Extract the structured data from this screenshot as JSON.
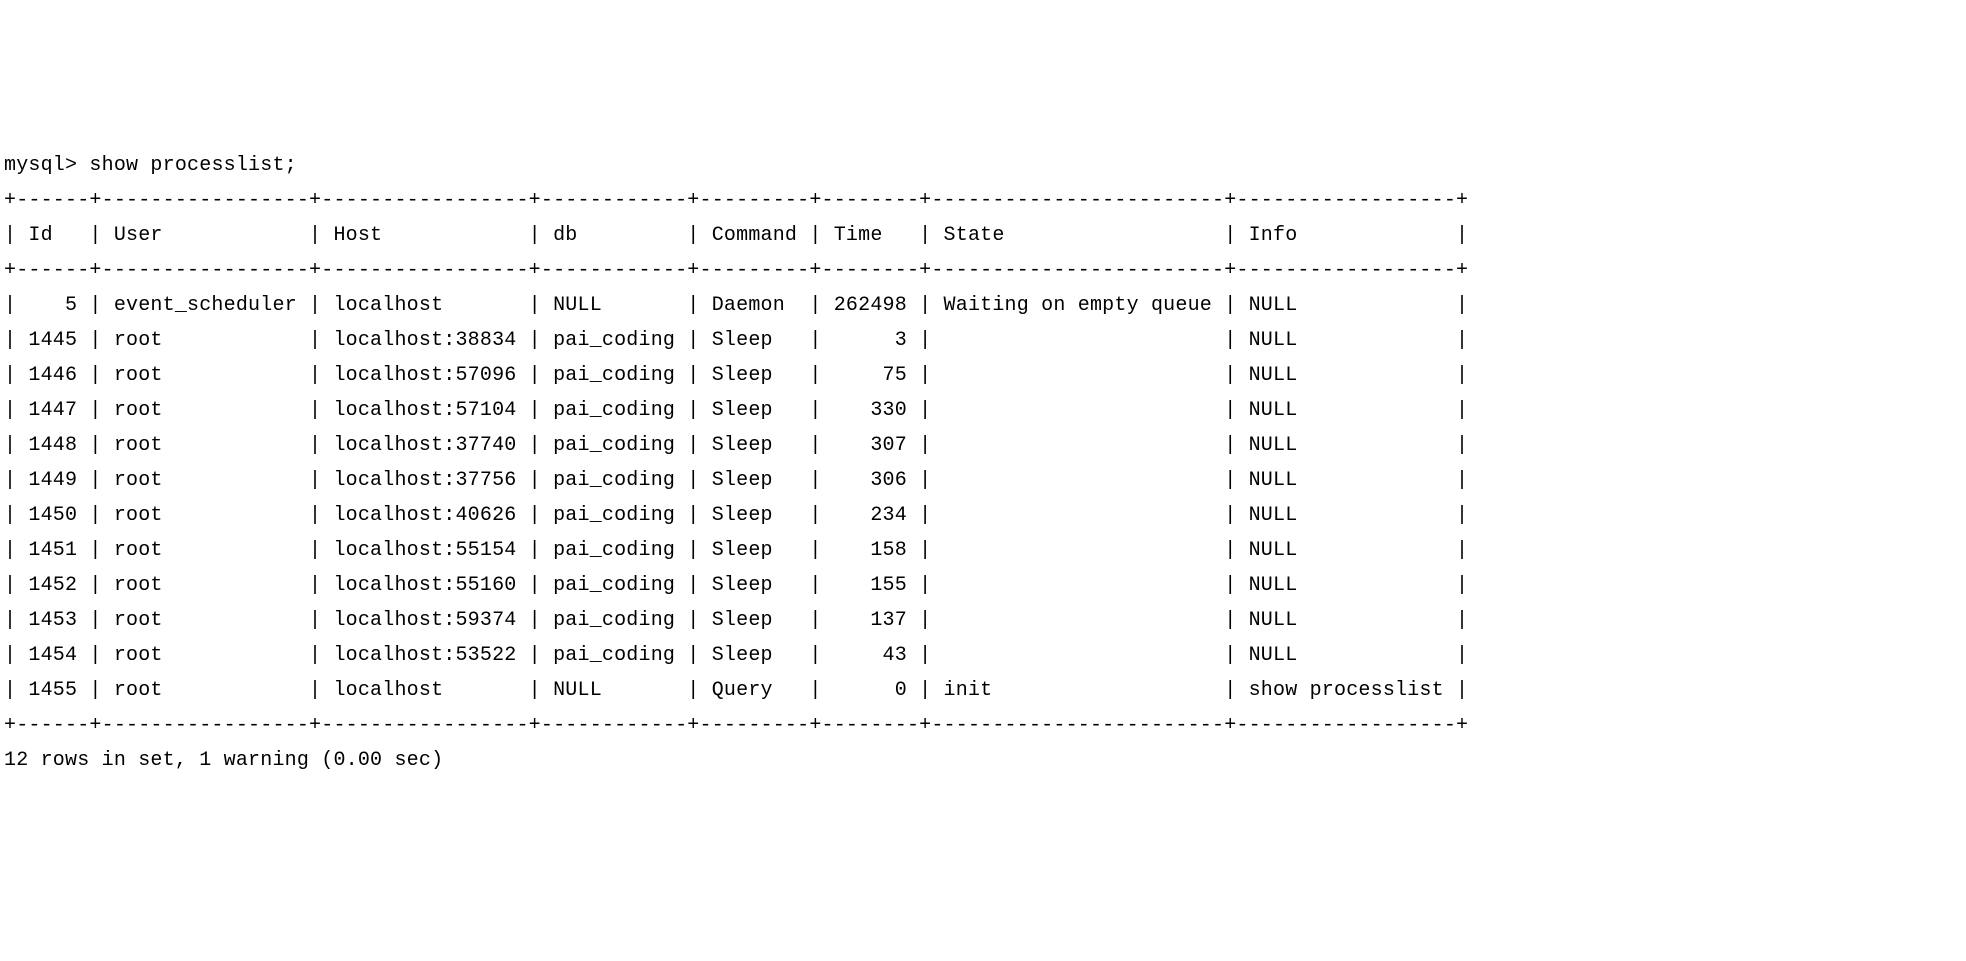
{
  "prompt": "mysql> ",
  "command": "show processlist;",
  "columns": [
    "Id",
    "User",
    "Host",
    "db",
    "Command",
    "Time",
    "State",
    "Info"
  ],
  "widths": {
    "Id": 4,
    "User": 15,
    "Host": 15,
    "db": 10,
    "Command": 7,
    "Time": 6,
    "State": 22,
    "Info": 16
  },
  "rows": [
    {
      "Id": "5",
      "User": "event_scheduler",
      "Host": "localhost",
      "db": "NULL",
      "Command": "Daemon",
      "Time": "262498",
      "State": "Waiting on empty queue",
      "Info": "NULL"
    },
    {
      "Id": "1445",
      "User": "root",
      "Host": "localhost:38834",
      "db": "pai_coding",
      "Command": "Sleep",
      "Time": "3",
      "State": "",
      "Info": "NULL"
    },
    {
      "Id": "1446",
      "User": "root",
      "Host": "localhost:57096",
      "db": "pai_coding",
      "Command": "Sleep",
      "Time": "75",
      "State": "",
      "Info": "NULL"
    },
    {
      "Id": "1447",
      "User": "root",
      "Host": "localhost:57104",
      "db": "pai_coding",
      "Command": "Sleep",
      "Time": "330",
      "State": "",
      "Info": "NULL"
    },
    {
      "Id": "1448",
      "User": "root",
      "Host": "localhost:37740",
      "db": "pai_coding",
      "Command": "Sleep",
      "Time": "307",
      "State": "",
      "Info": "NULL"
    },
    {
      "Id": "1449",
      "User": "root",
      "Host": "localhost:37756",
      "db": "pai_coding",
      "Command": "Sleep",
      "Time": "306",
      "State": "",
      "Info": "NULL"
    },
    {
      "Id": "1450",
      "User": "root",
      "Host": "localhost:40626",
      "db": "pai_coding",
      "Command": "Sleep",
      "Time": "234",
      "State": "",
      "Info": "NULL"
    },
    {
      "Id": "1451",
      "User": "root",
      "Host": "localhost:55154",
      "db": "pai_coding",
      "Command": "Sleep",
      "Time": "158",
      "State": "",
      "Info": "NULL"
    },
    {
      "Id": "1452",
      "User": "root",
      "Host": "localhost:55160",
      "db": "pai_coding",
      "Command": "Sleep",
      "Time": "155",
      "State": "",
      "Info": "NULL"
    },
    {
      "Id": "1453",
      "User": "root",
      "Host": "localhost:59374",
      "db": "pai_coding",
      "Command": "Sleep",
      "Time": "137",
      "State": "",
      "Info": "NULL"
    },
    {
      "Id": "1454",
      "User": "root",
      "Host": "localhost:53522",
      "db": "pai_coding",
      "Command": "Sleep",
      "Time": "43",
      "State": "",
      "Info": "NULL"
    },
    {
      "Id": "1455",
      "User": "root",
      "Host": "localhost",
      "db": "NULL",
      "Command": "Query",
      "Time": "0",
      "State": "init",
      "Info": "show processlist"
    }
  ],
  "footer": "12 rows in set, 1 warning (0.00 sec)"
}
